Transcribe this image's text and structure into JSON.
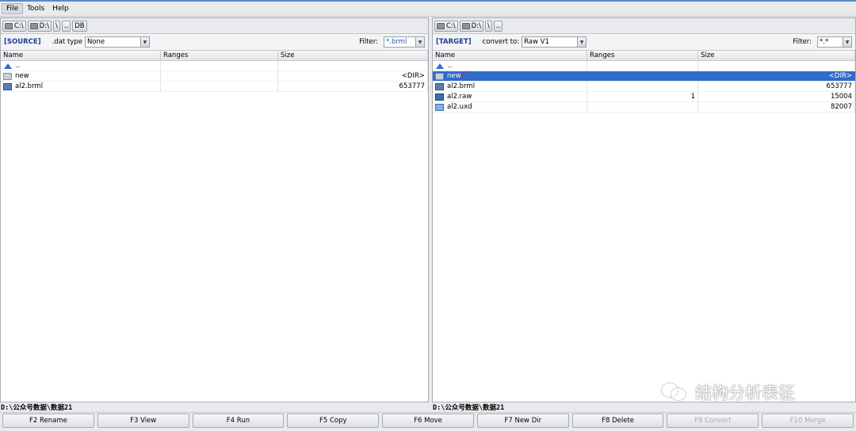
{
  "menu": [
    "File",
    "Tools",
    "Help"
  ],
  "left": {
    "drives": [
      "C:\\",
      "D:\\",
      "\\",
      "..",
      "DB"
    ],
    "tag": "[SOURCE]",
    "opt_label": ".dat type",
    "opt_value": "None",
    "filter_label": "Filter:",
    "filter_value": "*.brml",
    "columns": [
      "Name",
      "Ranges",
      "Size"
    ],
    "rows": [
      {
        "icon": "up-arrow-icon",
        "name": "..",
        "ranges": "",
        "size": ""
      },
      {
        "icon": "folder-icon",
        "name": "new",
        "ranges": "",
        "size": "<DIR>"
      },
      {
        "icon": "brml-file-icon",
        "name": "al2.brml",
        "ranges": "",
        "size": "653777"
      }
    ],
    "path": "D:\\公众号数据\\数据21"
  },
  "right": {
    "drives": [
      "C:\\",
      "D:\\",
      "\\",
      ".."
    ],
    "tag": "[TARGET]",
    "opt_label": "convert to:",
    "opt_value": "Raw V1",
    "filter_label": "Filter:",
    "filter_value": "*.*",
    "columns": [
      "Name",
      "Ranges",
      "Size"
    ],
    "rows": [
      {
        "icon": "up-arrow-icon",
        "name": "..",
        "ranges": "",
        "size": ""
      },
      {
        "icon": "folder-icon",
        "name": "new",
        "ranges": "",
        "size": "<DIR>",
        "selected": true
      },
      {
        "icon": "brml-file-icon",
        "name": "al2.brml",
        "ranges": "",
        "size": "653777"
      },
      {
        "icon": "raw-file-icon",
        "name": "al2.raw",
        "ranges": "1",
        "size": "15004"
      },
      {
        "icon": "uxd-file-icon",
        "name": "al2.uxd",
        "ranges": "",
        "size": "82007"
      }
    ],
    "path": "D:\\公众号数据\\数据21"
  },
  "fkeys": [
    {
      "label": "F2 Rename",
      "enabled": true
    },
    {
      "label": "F3 View",
      "enabled": true
    },
    {
      "label": "F4 Run",
      "enabled": true
    },
    {
      "label": "F5 Copy",
      "enabled": true
    },
    {
      "label": "F6 Move",
      "enabled": true
    },
    {
      "label": "F7 New Dir",
      "enabled": true
    },
    {
      "label": "F8 Delete",
      "enabled": true
    },
    {
      "label": "F9 Convert",
      "enabled": false
    },
    {
      "label": "F10 Merge",
      "enabled": false
    }
  ],
  "watermark": "结构分析表征",
  "colors": {
    "selection": "#2f6ccc",
    "tag": "#1e3f96",
    "check_mark": "#d62828"
  }
}
